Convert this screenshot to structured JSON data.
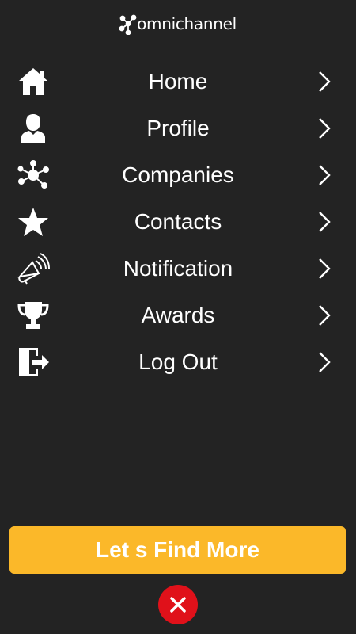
{
  "app": {
    "logo_text": "omnichannel",
    "logo_icon": "network-nodes-icon"
  },
  "menu": {
    "items": [
      {
        "label": "Home",
        "icon": "home-icon"
      },
      {
        "label": "Profile",
        "icon": "user-icon"
      },
      {
        "label": "Companies",
        "icon": "network-icon"
      },
      {
        "label": "Contacts",
        "icon": "star-icon"
      },
      {
        "label": "Notification",
        "icon": "megaphone-icon"
      },
      {
        "label": "Awards",
        "icon": "trophy-icon"
      },
      {
        "label": "Log Out",
        "icon": "logout-door-icon"
      }
    ],
    "chevron_icon": "chevron-right-icon"
  },
  "cta": {
    "label": "Let s Find More",
    "color": "#fbb829"
  },
  "close": {
    "icon": "close-icon",
    "color": "#e0111a"
  },
  "colors": {
    "background": "#232323",
    "text": "#ffffff"
  }
}
